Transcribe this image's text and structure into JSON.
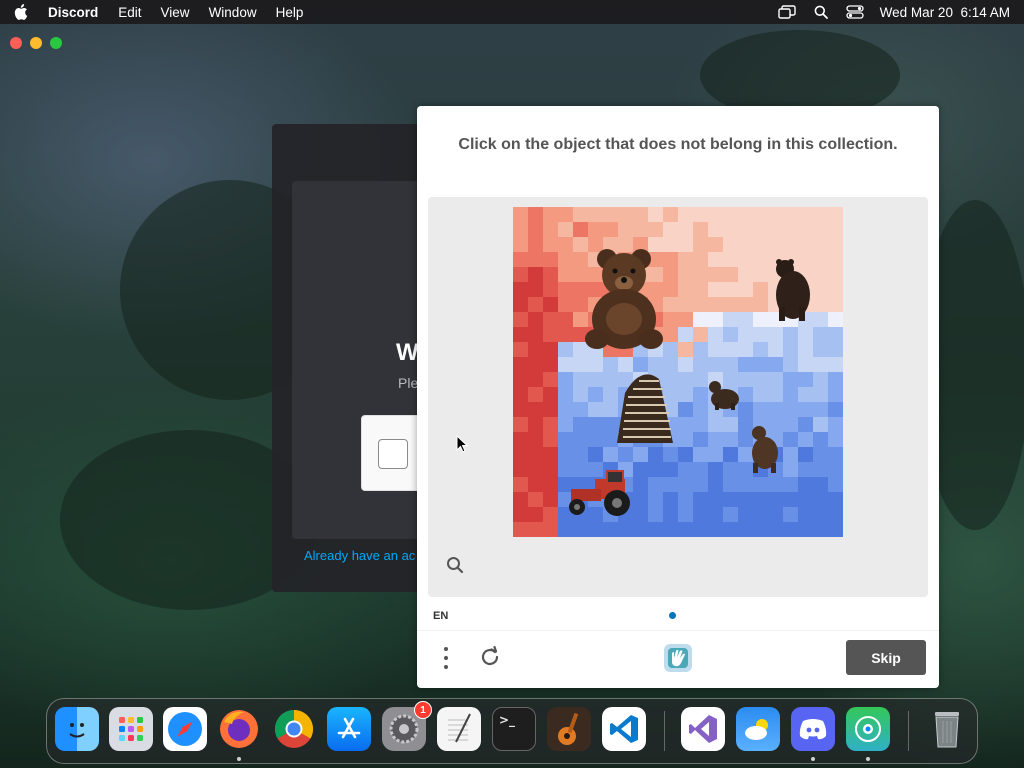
{
  "menubar": {
    "app_name": "Discord",
    "menus": [
      "Edit",
      "View",
      "Window",
      "Help"
    ],
    "datetime": "Wed Mar 20  6:14 AM"
  },
  "discord": {
    "heading": "Welcome back!",
    "subtitle": "Please",
    "link": "Already have an account?"
  },
  "captcha": {
    "prompt": "Click on the object that does not belong in this collection.",
    "language": "EN",
    "skip_label": "Skip",
    "objects": [
      "teddy-bear",
      "brown-bear",
      "striped-bear",
      "cub-bear",
      "standing-bear",
      "tractor"
    ]
  },
  "dock": {
    "apps": [
      "Finder",
      "Launchpad",
      "Safari",
      "Firefox",
      "Chrome",
      "App Store",
      "System Settings",
      "TextEdit",
      "Terminal",
      "GarageBand",
      "Visual Studio Code",
      "Visual Studio",
      "Weather",
      "Discord",
      "Find My",
      "Trash"
    ],
    "settings_badge": "1"
  },
  "colors": {
    "skip_button": "#555555",
    "progress_dot": "#0074bf",
    "prompt_text": "#555555"
  }
}
